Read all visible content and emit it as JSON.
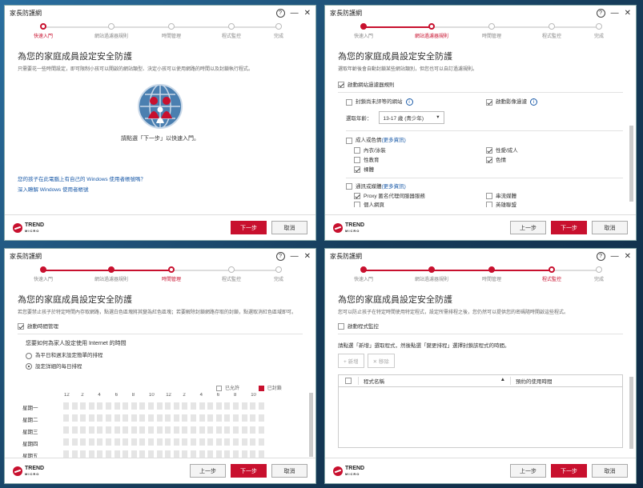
{
  "window_title": "家長防護網",
  "steps": [
    "快速入門",
    "網站過濾器規則",
    "時間管理",
    "程式監控",
    "完成"
  ],
  "heading": "為您的家庭成員設定安全防護",
  "buttons": {
    "back": "上一步",
    "next": "下一步",
    "cancel": "取消"
  },
  "logo": {
    "brand": "TREND",
    "sub": "MICRO"
  },
  "colors": {
    "accent": "#c8102e",
    "link": "#1a5aa8"
  },
  "panel1": {
    "subtitle": "只需要花一些時間設定，即可限制小孩可以開啟的網站類型、決定小孩可以使用網路的時間以及封鎖執行程式。",
    "instruction": "請點選「下一步」以快速入門。",
    "link1": "您的孩子在此電腦上有自己的 Windows 使用者帳號嗎？",
    "link2": "深入瞭解 Windows 使用者帳號"
  },
  "panel2": {
    "subtitle": "選取年齡後會自動封鎖某些網站類別，但您也可以自訂過濾規則。",
    "enable": "啟動網站過濾器規則",
    "unrated": "封鎖尚未評等的網站",
    "safe_image": "啟動影像過濾",
    "age_label": "選取年齡：",
    "age_value": "13-17 歲 (青少年)",
    "cat_adult": {
      "title": "成人或色情",
      "more": "(更多資訊)",
      "items": [
        {
          "label": "內衣/泳裝",
          "on": false
        },
        {
          "label": "性愛/成人",
          "on": true
        },
        {
          "label": "性教育",
          "on": false
        },
        {
          "label": "色情",
          "on": true
        },
        {
          "label": "裸體",
          "on": true
        }
      ]
    },
    "cat_comm": {
      "title": "通訊或媒體",
      "more": "(更多資訊)",
      "items": [
        {
          "label": "Proxy 匿名代理伺服器服務",
          "on": true
        },
        {
          "label": "串流媒體",
          "on": false
        },
        {
          "label": "個人網頁",
          "on": false
        },
        {
          "label": "英雄聯盟",
          "on": false
        }
      ]
    }
  },
  "panel3": {
    "subtitle": "若您要禁止孩子於特定時間內存取網路，點選白色區塊將其變為紅色區塊；若要解除封鎖網路存取的封鎖，點選取消紅色區域即可。",
    "enable": "啟動時間管理",
    "question": "您要如何為家人設定使用 Internet 的時間",
    "opt1": "為平日和週末設定簡單的排程",
    "opt2": "設定詳細的每日排程",
    "legend_allowed": "已允許",
    "legend_blocked": "已封鎖",
    "hours": [
      "12",
      "2",
      "4",
      "6",
      "8",
      "10",
      "12",
      "2",
      "4",
      "6",
      "8",
      "10"
    ],
    "days": [
      "星期一",
      "星期二",
      "星期三",
      "星期四",
      "星期五"
    ]
  },
  "panel4": {
    "subtitle": "您可以防止孩子在特定時間使用特定程式，設定所需排程之後，您仍然可以提供您的密碼隨時開啟這些程式。",
    "enable": "啟動程式監控",
    "instruction": "請點選「新增」選取程式，然後點選「變更排程」選擇封鎖該程式的時間。",
    "add": "+ 新增",
    "remove": "✕ 移除",
    "col_name": "程式名稱",
    "col_time": "預約的使用時間"
  }
}
